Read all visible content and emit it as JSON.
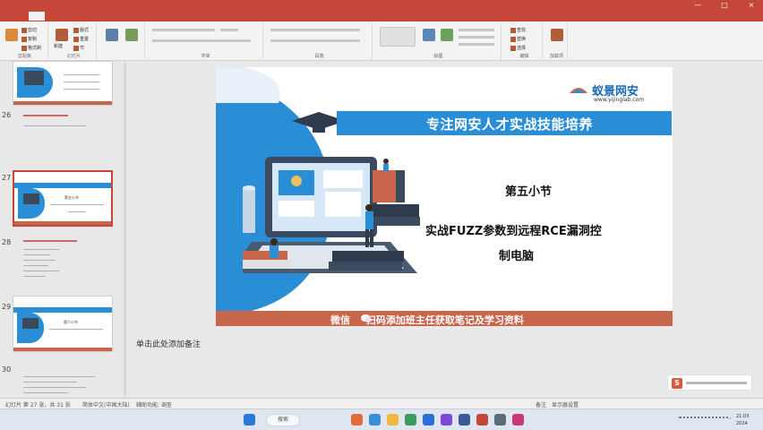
{
  "window": {
    "title": "",
    "controls": [
      "—",
      "□",
      "×"
    ]
  },
  "ribbon": {
    "tabs": [
      "",
      "",
      "",
      "",
      "",
      "",
      "",
      "",
      ""
    ],
    "groups": [
      {
        "label": "剪贴板",
        "items": [
          "剪切",
          "复制",
          "格式刷"
        ]
      },
      {
        "label": "幻灯片",
        "items": [
          "新建",
          "版式",
          "重置",
          "节"
        ]
      },
      {
        "label": "",
        "items": []
      },
      {
        "label": "字体",
        "items": []
      },
      {
        "label": "段落",
        "items": []
      },
      {
        "label": "绘图",
        "items": []
      },
      {
        "label": "编辑",
        "items": [
          "查找",
          "替换",
          "选择"
        ]
      },
      {
        "label": "加载项",
        "items": []
      }
    ]
  },
  "thumbnails": [
    {
      "num": "26",
      "text": "第四小节"
    },
    {
      "num": "27",
      "text": "第五小节"
    },
    {
      "num": "28",
      "text": ""
    },
    {
      "num": "29",
      "text": "第六小节"
    },
    {
      "num": "30",
      "text": ""
    }
  ],
  "slide": {
    "logo": "蚁景网安",
    "logo_url": "www.yijinglab.com",
    "banner": "专注网安人才实战技能培养",
    "section": "第五小节",
    "topic_line1": "实战FUZZ参数到远程RCE漏洞控",
    "topic_line2": "制电脑",
    "footer_prefix": "微信",
    "footer_text": "扫码添加班主任获取笔记及学习资料",
    "colors": {
      "accent_blue": "#2a8ed6",
      "footer": "#c7664b"
    }
  },
  "notes": {
    "placeholder": "单击此处添加备注"
  },
  "statusbar": {
    "slide_info": "幻灯片 第 27 张，共 31 张",
    "language": "简体中文(中国大陆)",
    "accessibility": "辅助功能: 调查",
    "notes_btn": "备注",
    "display_btn": "显示器设置"
  },
  "taskbar": {
    "search": "搜索",
    "time": "21:03",
    "date": "2024"
  },
  "float": {
    "label": "S"
  }
}
